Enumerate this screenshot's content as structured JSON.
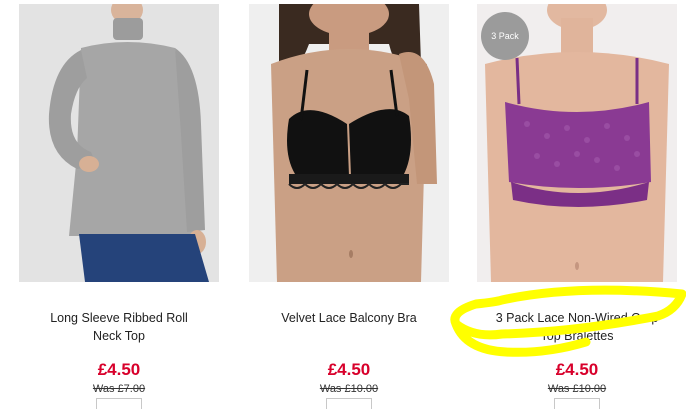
{
  "products": [
    {
      "title_line1": "Long Sleeve Ribbed Roll",
      "title_line2": "Neck Top",
      "price": "£4.50",
      "was_price": "Was £7.00",
      "image_alt": "grey roll neck top"
    },
    {
      "title_line1": "Velvet Lace Balcony Bra",
      "title_line2": "",
      "price": "£4.50",
      "was_price": "Was £10.00",
      "image_alt": "black velvet lace balcony bra"
    },
    {
      "title_line1": "3 Pack Lace Non-Wired Crop",
      "title_line2": "Top Bralettes",
      "price": "£4.50",
      "was_price": "Was £10.00",
      "badge": "3 Pack",
      "image_alt": "purple lace bralette"
    }
  ],
  "colors": {
    "price_red": "#d8002b",
    "highlight_yellow": "#ffff00"
  }
}
